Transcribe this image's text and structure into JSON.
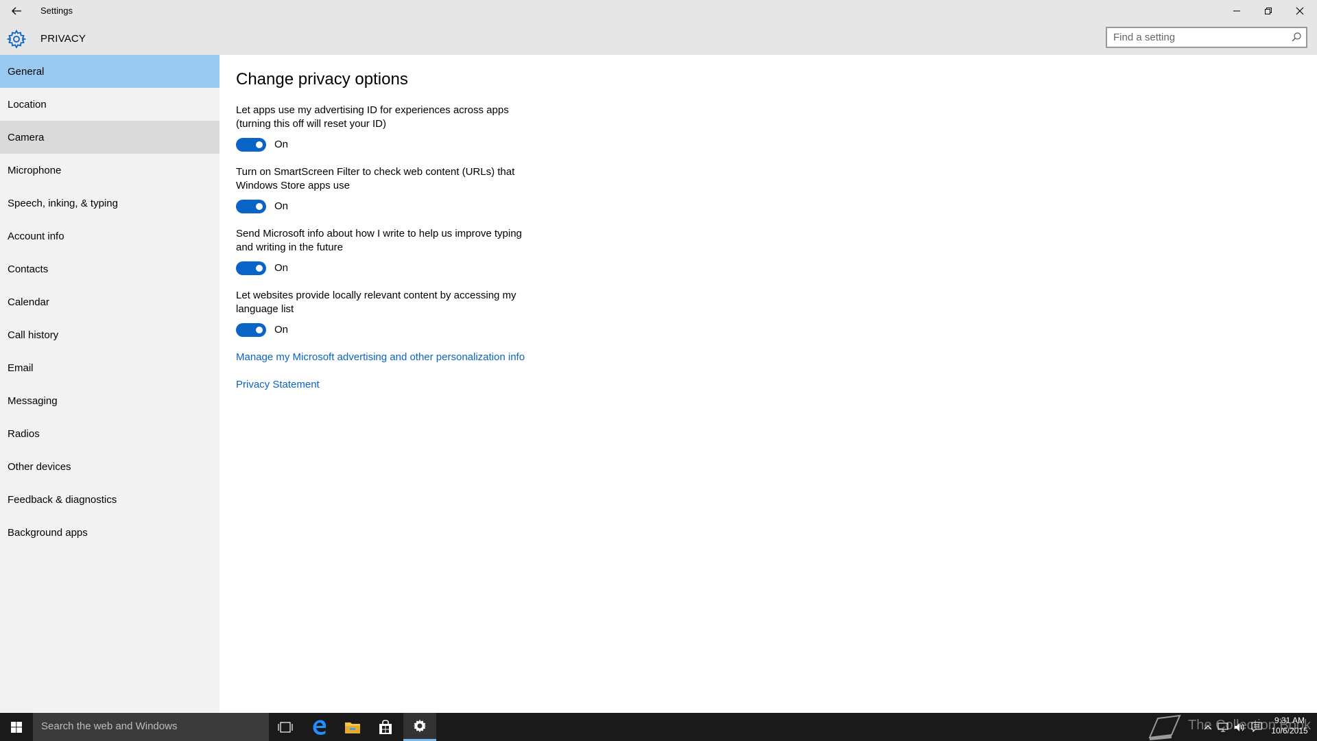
{
  "window": {
    "title": "Settings",
    "section": "PRIVACY",
    "search_placeholder": "Find a setting"
  },
  "sidebar": {
    "items": [
      {
        "label": "General"
      },
      {
        "label": "Location"
      },
      {
        "label": "Camera"
      },
      {
        "label": "Microphone"
      },
      {
        "label": "Speech, inking, & typing"
      },
      {
        "label": "Account info"
      },
      {
        "label": "Contacts"
      },
      {
        "label": "Calendar"
      },
      {
        "label": "Call history"
      },
      {
        "label": "Email"
      },
      {
        "label": "Messaging"
      },
      {
        "label": "Radios"
      },
      {
        "label": "Other devices"
      },
      {
        "label": "Feedback & diagnostics"
      },
      {
        "label": "Background apps"
      }
    ],
    "selected": "General",
    "hovered": "Camera"
  },
  "main": {
    "title": "Change privacy options",
    "options": [
      {
        "line1": "Let apps use my advertising ID for experiences across apps",
        "line2": "(turning this off will reset your ID)",
        "state": "On"
      },
      {
        "line1": "Turn on SmartScreen Filter to check web content (URLs) that",
        "line2": "Windows Store apps use",
        "state": "On"
      },
      {
        "line1": "Send Microsoft info about how I write to help us improve typing",
        "line2": "and writing in the future",
        "state": "On"
      },
      {
        "line1": "Let websites provide locally relevant content by accessing my",
        "line2": "language list",
        "state": "On"
      }
    ],
    "links": [
      "Manage my Microsoft advertising and other personalization info",
      "Privacy Statement"
    ]
  },
  "taskbar": {
    "search_text": "Search the web and Windows",
    "watermark": "The Collection Book",
    "time": "9:31 AM",
    "date": "10/6/2015"
  },
  "colors": {
    "accent": "#0a63c7",
    "selected_nav": "#99c9ef",
    "hover_nav": "#dadada",
    "sidebar_bg": "#f2f2f2",
    "titlebar_bg": "#e6e6e6",
    "taskbar_bg": "#1a1a1a"
  }
}
